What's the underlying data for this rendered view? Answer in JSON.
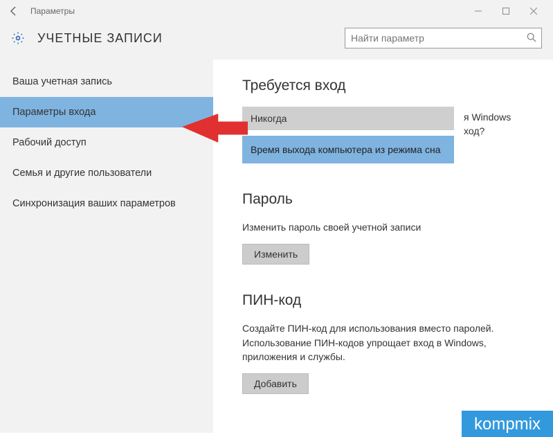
{
  "window": {
    "title": "Параметры",
    "header": "УЧЕТНЫЕ ЗАПИСИ",
    "search_placeholder": "Найти параметр"
  },
  "sidebar": {
    "items": [
      {
        "label": "Ваша учетная запись",
        "selected": false
      },
      {
        "label": "Параметры входа",
        "selected": true
      },
      {
        "label": "Рабочий доступ",
        "selected": false
      },
      {
        "label": "Семья и другие пользователи",
        "selected": false
      },
      {
        "label": "Синхронизация ваших параметров",
        "selected": false
      }
    ]
  },
  "signin": {
    "heading": "Требуется вход",
    "question_fragment": "я Windows ход?",
    "dropdown_selected": "Никогда",
    "dropdown_option": "Время выхода компьютера из режима сна"
  },
  "password": {
    "heading": "Пароль",
    "desc": "Изменить пароль своей учетной записи",
    "button": "Изменить"
  },
  "pin": {
    "heading": "ПИН-код",
    "desc": "Создайте ПИН-код для использования вместо паролей. Использование ПИН-кодов упрощает вход в Windows, приложения и службы.",
    "button": "Добавить"
  },
  "watermark": {
    "main": "kompmix",
    "sub": ""
  }
}
